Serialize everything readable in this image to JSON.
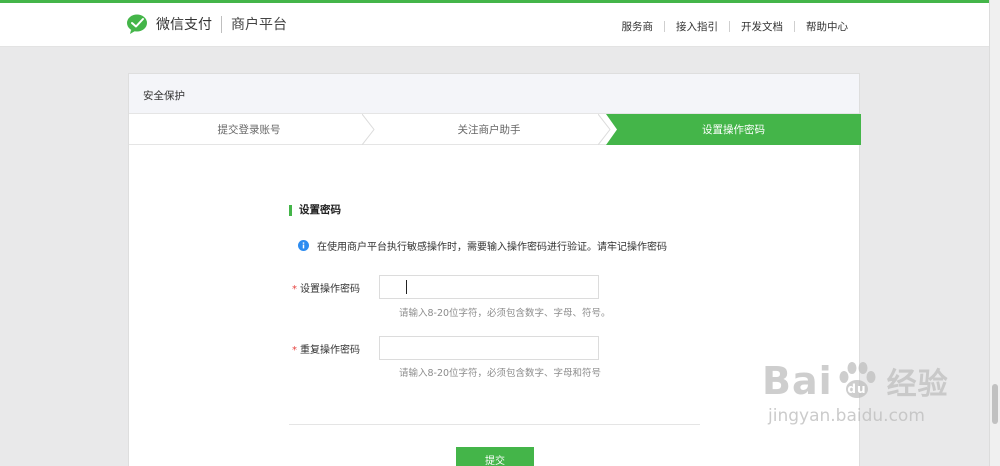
{
  "header": {
    "brand": "微信支付",
    "platform": "商户平台",
    "nav": [
      "服务商",
      "接入指引",
      "开发文档",
      "帮助中心"
    ],
    "logo_icon": "wechat-icon"
  },
  "card": {
    "title": "安全保护",
    "steps": [
      "提交登录账号",
      "关注商户助手",
      "设置操作密码"
    ],
    "active_step": 3
  },
  "form": {
    "section_title": "设置密码",
    "notice": "在使用商户平台执行敏感操作时，需要输入操作密码进行验证。请牢记操作密码",
    "fields": [
      {
        "label": "设置操作密码",
        "required_mark": "*",
        "value": "",
        "hint": "请输入8-20位字符，必须包含数字、字母、符号。"
      },
      {
        "label": "重复操作密码",
        "required_mark": "*",
        "value": "",
        "hint": "请输入8-20位字符，必须包含数字、字母和符号"
      }
    ],
    "submit_label": "提交"
  },
  "watermark": {
    "logo_left": "Bai",
    "logo_right": "经验",
    "url": "jingyan.baidu.com"
  },
  "colors": {
    "accent": "#44b549",
    "required": "#e64340",
    "info": "#2d8cf0"
  }
}
